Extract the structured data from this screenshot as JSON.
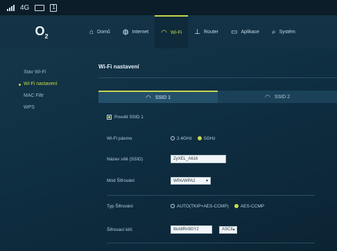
{
  "statusbar": {
    "network_type": "4G"
  },
  "topnav": {
    "logo": "O",
    "logo_sub": "2",
    "tabs": [
      {
        "label": "Domů",
        "icon": "home-icon"
      },
      {
        "label": "Internet",
        "icon": "globe-icon"
      },
      {
        "label": "Wi-Fi",
        "icon": "wifi-icon"
      },
      {
        "label": "Router",
        "icon": "router-icon"
      },
      {
        "label": "Aplikace",
        "icon": "apps-icon"
      },
      {
        "label": "Systém",
        "icon": "search-icon"
      }
    ],
    "active_tab": "Wi-Fi",
    "accent": "#c9d94a"
  },
  "sidebar": {
    "items": [
      {
        "label": "Stav Wi-Fi"
      },
      {
        "label": "Wi-Fi nastavení"
      },
      {
        "label": "MAC Filtr"
      },
      {
        "label": "WPS"
      }
    ],
    "active_item": "Wi-Fi nastavení"
  },
  "main": {
    "title": "Wi-Fi nastavení",
    "ssid_tabs": [
      {
        "label": "SSID 1"
      },
      {
        "label": "SSID 2"
      }
    ],
    "enable_ssid": {
      "label": "Povolit SSID 1",
      "checked": true
    },
    "band": {
      "label": "Wi-Fi pásmo",
      "options": [
        "2.4GHz",
        "5GHz"
      ],
      "selected": "5GHz"
    },
    "ssid_name": {
      "label": "Název sítě (SSID)",
      "value": "ZyXEL_A616"
    },
    "security_mode": {
      "label": "Mód Šifrování",
      "value": "WPA/WPA2"
    },
    "encryption_type": {
      "label": "Typ Šifrování",
      "options": [
        "AUTO(TKIP+AES-CCMP)",
        "AES-CCMP"
      ],
      "selected": "AES-CCMP"
    },
    "security_key": {
      "label": "Šifrovací klíč",
      "value": "8kA8Rn9GY2",
      "format": "ASCII"
    }
  }
}
